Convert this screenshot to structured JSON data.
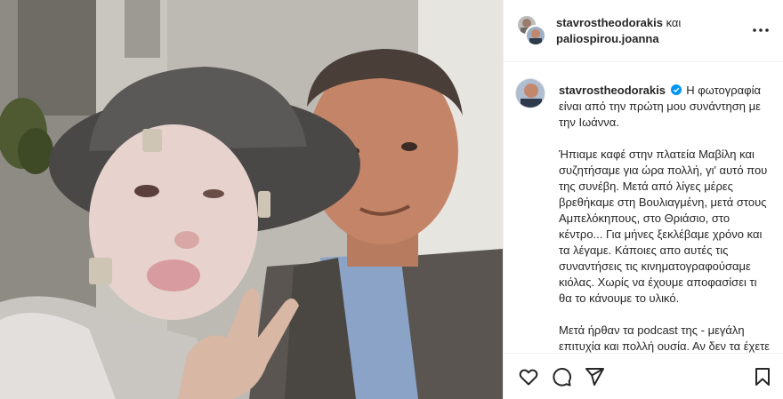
{
  "post": {
    "author_primary": "stavrostheodorakis",
    "connector": "και",
    "author_collab": "paliospirou.joanna",
    "more_icon": "more-horizontal-icon",
    "caption_author": "stavrostheodorakis",
    "verified_icon": "verified-badge-icon",
    "caption_lead": "Η φωτογραφία είναι από την πρώτη μου συνάντηση με την Ιωάννα.",
    "caption_p2": "Ήπιαμε καφέ στην πλατεία Μαβίλη και συζητήσαμε για ώρα πολλή, γι' αυτό που της συνέβη. Μετά από λίγες μέρες βρεθήκαμε στη Βουλιαγμένη, μετά στους Αμπελόκηπους, στο Θριάσιο, στο κέντρο... Για μήνες ξεκλέβαμε χρόνο και τα λέγαμε. Κάποιες απο αυτές τις συναντήσεις τις κινηματογραφούσαμε κιόλας.  Χωρίς να έχουμε αποφασίσει τι θα το κάνουμε το υλικό.",
    "caption_p3": "Μετά ήρθαν τα podcast της - μεγάλη επιτυχία και πολλή ουσία. Αν δεν τα έχετε ακούσει ακόμη, αναζητείστε τα"
  },
  "actions": {
    "like_icon": "heart-icon",
    "comment_icon": "comment-icon",
    "share_icon": "share-icon",
    "save_icon": "bookmark-icon"
  },
  "colors": {
    "verified": "#0095f6",
    "text": "#262626",
    "divider": "#efefef"
  }
}
